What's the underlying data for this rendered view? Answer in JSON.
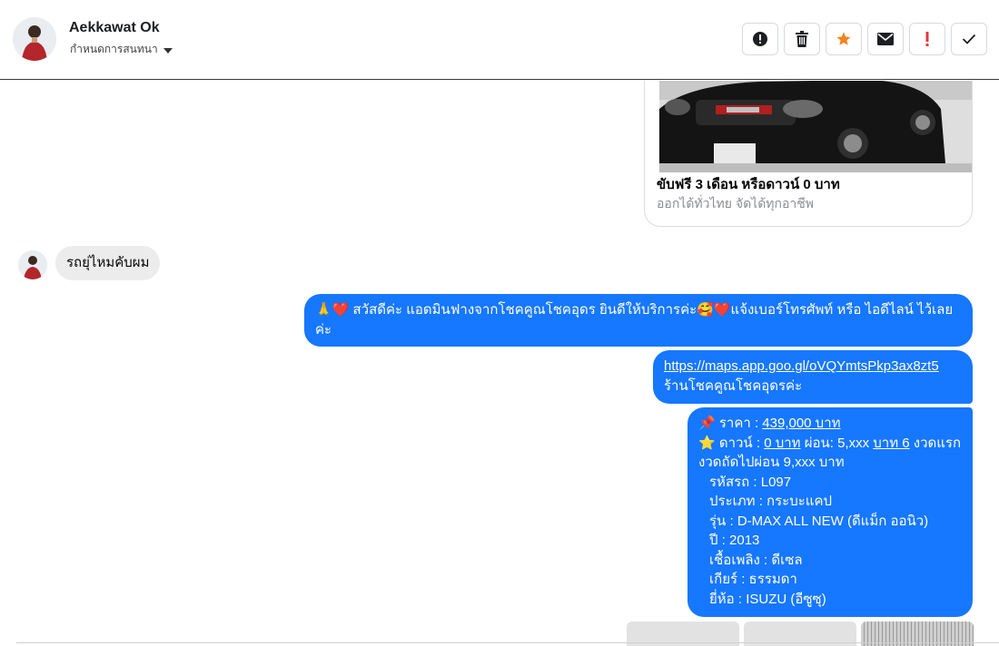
{
  "header": {
    "name": "Aekkawat Ok",
    "assign_label": "กำหนดการสนทนา",
    "actions": [
      "report-icon",
      "trash-icon",
      "star-icon",
      "mail-icon",
      "important-icon",
      "check-icon"
    ]
  },
  "card": {
    "title": "ขับฟรี 3 เดือน หรือดาวน์ 0 บาท",
    "subtitle": "ออกได้ทั่วไทย จัดได้ทุกอาชีพ"
  },
  "incoming": {
    "text": "รถยุ่ไหมคับผม"
  },
  "outgoing": {
    "greeting": "🙏❤️ สวัสดีค่ะ แอดมินฟางจากโชคคูณโชคอุดร ยินดีให้บริการค่ะ🥰❤️แจ้งเบอร์โทรศัพท์ หรือ ไอดีไลน์  ไว้เลยค่ะ",
    "map_link": "https://maps.app.goo.gl/oVQYmtsPkp3ax8zt5",
    "map_caption": "ร้านโชคคูณโชคอุดรค่ะ",
    "price_prefix": "📌 ราคา : ",
    "price": "439,000 บาท",
    "down_prefix": "⭐ ดาวน์ : ",
    "down": "0 บาท",
    "down_mid": " ผ่อน: 5,xxx ",
    "down_term": "บาท 6",
    "down_suffix": " งวดแรก",
    "next_pay": "งวดถัดไปผ่อน  9,xxx บาท",
    "car_code": "รหัสรถ : L097",
    "car_type": "ประเภท : กระบะแคป",
    "car_model": "รุ่น : D-MAX ALL NEW (ดีแม็ก ออนิว)",
    "car_year": "ปี : 2013",
    "car_fuel": "เชื้อเพลิง : ดีเซล",
    "car_gear": "เกียร์ : ธรรมดา",
    "car_brand": "ยี่ห้อ : ISUZU (อีซูซุ)"
  },
  "colors": {
    "accent": "#1677ff",
    "star": "#f5821f",
    "important": "#e4393c"
  }
}
